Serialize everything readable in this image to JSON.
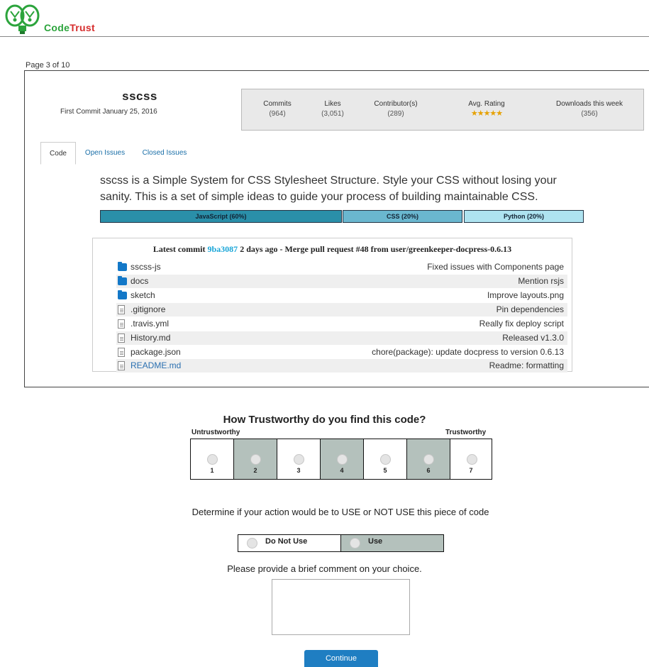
{
  "brand": {
    "code": "Code",
    "trust": "Trust"
  },
  "page_indicator": "Page 3 of 10",
  "repo": {
    "name": "sscss",
    "first_commit": "First Commit January 25, 2016",
    "stats": [
      {
        "label": "Commits",
        "value": "(964)"
      },
      {
        "label": "Likes",
        "value": "(3,051)"
      },
      {
        "label": "Contributor(s)",
        "value": "(289)"
      },
      {
        "label": "Avg. Rating",
        "value": "★★★★★"
      },
      {
        "label": "Downloads this week",
        "value": "(356)"
      }
    ],
    "tabs": [
      "Code",
      "Open Issues",
      "Closed Issues"
    ],
    "description": "sscss is a Simple System for CSS Stylesheet Structure. Style your CSS without losing your sanity. This is a set of simple ideas to guide your process of building maintainable CSS.",
    "languages": [
      {
        "label": "JavaScript (60%)",
        "color": "#2a8fa9"
      },
      {
        "label": "CSS (20%)",
        "color": "#6ab7cf"
      },
      {
        "label": "Python (20%)",
        "color": "#aee3f0"
      }
    ],
    "commit": {
      "prefix": "Latest commit",
      "hash": "9ba3087",
      "suffix": "2 days ago - Merge pull request #48 from user/greenkeeper-docpress-0.6.13"
    },
    "files": [
      {
        "name": "sscss-js",
        "type": "folder",
        "message": "Fixed issues with Components page"
      },
      {
        "name": "docs",
        "type": "folder",
        "message": "Mention rsjs"
      },
      {
        "name": "sketch",
        "type": "folder",
        "message": "Improve layouts.png"
      },
      {
        "name": ".gitignore",
        "type": "file",
        "message": "Pin dependencies"
      },
      {
        "name": ".travis.yml",
        "type": "file",
        "message": "Really fix deploy script"
      },
      {
        "name": "History.md",
        "type": "file",
        "message": "Released v1.3.0"
      },
      {
        "name": "package.json",
        "type": "file",
        "message": "chore(package): update docpress to version 0.6.13"
      },
      {
        "name": "README.md",
        "type": "file",
        "message": "Readme: formatting"
      }
    ]
  },
  "survey": {
    "trust_question": "How Trustworthy do you find this code?",
    "scale_left": "Untrustworthy",
    "scale_right": "Trustworthy",
    "scale_options": [
      "1",
      "2",
      "3",
      "4",
      "5",
      "6",
      "7"
    ],
    "use_question": "Determine if your action would be to USE or NOT USE this piece of code",
    "use_options": [
      "Do Not Use",
      "Use"
    ],
    "comment_prompt": "Please provide a brief comment on your choice.",
    "comment_value": "",
    "continue_label": "Continue"
  },
  "colors": {
    "shade": "#b4c1bc",
    "button": "#1f7ec2",
    "link": "#1a6fa8",
    "folder": "#1378c8"
  }
}
